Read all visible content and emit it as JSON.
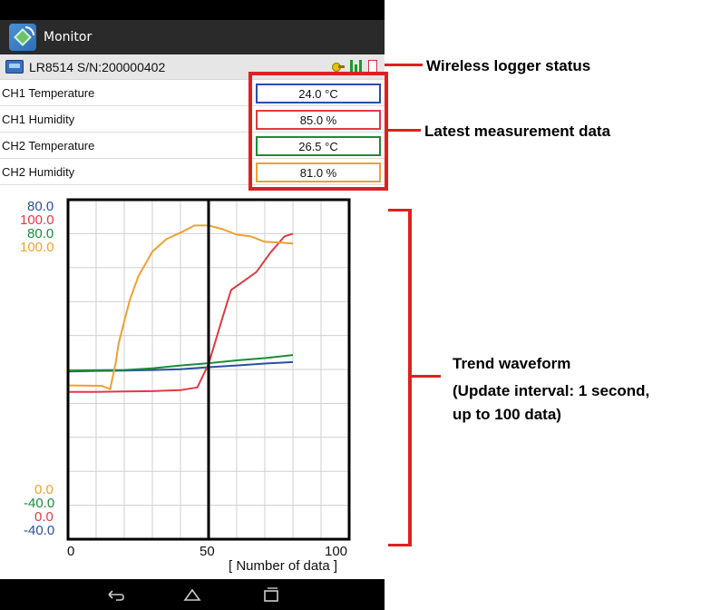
{
  "app": {
    "title": "Monitor"
  },
  "logger": {
    "name": "LR8514  S/N:200000402"
  },
  "measurements": [
    {
      "label": "CH1 Temperature",
      "value": "24.0 °C",
      "color": "#2b4fa0"
    },
    {
      "label": "CH1 Humidity",
      "value": "85.0 %",
      "color": "#e03a46"
    },
    {
      "label": "CH2 Temperature",
      "value": "26.5 °C",
      "color": "#1a8c3a"
    },
    {
      "label": "CH2 Humidity",
      "value": "81.0 %",
      "color": "#f0a030"
    }
  ],
  "chart": {
    "ymax_labels": [
      {
        "text": "80.0",
        "color": "#2b4fa0"
      },
      {
        "text": "100.0",
        "color": "#e03a46"
      },
      {
        "text": "80.0",
        "color": "#1a8c3a"
      },
      {
        "text": "100.0",
        "color": "#f0a030"
      }
    ],
    "ymin_labels": [
      {
        "text": "0.0",
        "color": "#f0a030"
      },
      {
        "text": "-40.0",
        "color": "#1a8c3a"
      },
      {
        "text": "0.0",
        "color": "#e03a46"
      },
      {
        "text": "-40.0",
        "color": "#2b4fa0"
      }
    ],
    "x_ticks": [
      "0",
      "50",
      "100"
    ],
    "x_unit": "[ Number of data ]"
  },
  "chart_data": {
    "type": "line",
    "xlim": [
      0,
      100
    ],
    "grid": true,
    "cursor_x": 50,
    "series": [
      {
        "name": "CH1 Temperature",
        "color": "#2b4fa0",
        "ylim": [
          -40,
          80
        ],
        "points": [
          [
            0,
            19.3
          ],
          [
            10,
            19.5
          ],
          [
            20,
            19.6
          ],
          [
            30,
            19.8
          ],
          [
            40,
            20.1
          ],
          [
            50,
            20.8
          ],
          [
            60,
            21.4
          ],
          [
            70,
            22.1
          ],
          [
            80,
            22.6
          ]
        ]
      },
      {
        "name": "CH1 Humidity",
        "color": "#e03a46",
        "ylim": [
          0,
          100
        ],
        "points": [
          [
            0,
            43.4
          ],
          [
            10,
            43.4
          ],
          [
            20,
            43.5
          ],
          [
            30,
            43.6
          ],
          [
            40,
            43.9
          ],
          [
            46,
            44.7
          ],
          [
            50,
            51.6
          ],
          [
            55,
            65.4
          ],
          [
            58,
            73.4
          ],
          [
            63,
            76.3
          ],
          [
            67,
            78.7
          ],
          [
            72,
            84.4
          ],
          [
            77,
            89.2
          ],
          [
            80,
            90.0
          ]
        ]
      },
      {
        "name": "CH2 Temperature",
        "color": "#1a8c3a",
        "ylim": [
          -40,
          80
        ],
        "points": [
          [
            0,
            19.6
          ],
          [
            10,
            19.7
          ],
          [
            20,
            19.8
          ],
          [
            30,
            20.4
          ],
          [
            40,
            21.4
          ],
          [
            50,
            22.2
          ],
          [
            60,
            23.2
          ],
          [
            70,
            24.0
          ],
          [
            80,
            25.1
          ]
        ]
      },
      {
        "name": "CH2 Humidity",
        "color": "#f0a030",
        "ylim": [
          0,
          100
        ],
        "points": [
          [
            0,
            45.3
          ],
          [
            12,
            45.2
          ],
          [
            15,
            44.2
          ],
          [
            17,
            52.1
          ],
          [
            18,
            57.6
          ],
          [
            20,
            64.2
          ],
          [
            22,
            70.5
          ],
          [
            25,
            77.4
          ],
          [
            30,
            84.7
          ],
          [
            35,
            88.4
          ],
          [
            40,
            90.3
          ],
          [
            45,
            92.4
          ],
          [
            50,
            92.4
          ],
          [
            55,
            91.3
          ],
          [
            60,
            89.7
          ],
          [
            65,
            89.2
          ],
          [
            70,
            87.6
          ],
          [
            75,
            87.4
          ],
          [
            80,
            87.1
          ]
        ]
      }
    ]
  },
  "annotations": {
    "wireless_status": "Wireless logger status",
    "latest_data": "Latest measurement data",
    "trend_line1": "Trend waveform",
    "trend_line2": "(Update interval:  1 second,",
    "trend_line3": "up to 100 data)"
  }
}
